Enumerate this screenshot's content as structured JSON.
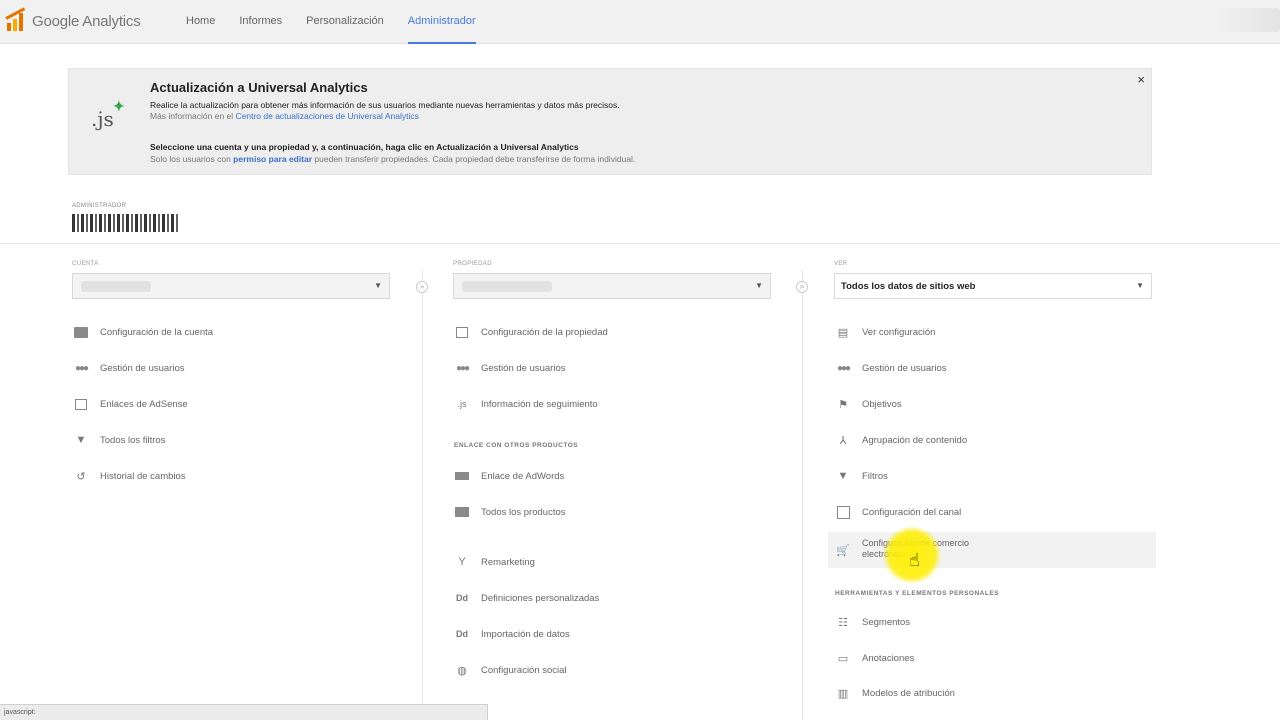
{
  "app": {
    "logo_text": "Google Analytics"
  },
  "nav": {
    "items": [
      {
        "label": "Home"
      },
      {
        "label": "Informes"
      },
      {
        "label": "Personalización"
      },
      {
        "label": "Administrador"
      }
    ],
    "active_index": 3,
    "accent": "#4a7bd6"
  },
  "banner": {
    "icon_text": ".js",
    "title": "Actualización a Universal Analytics",
    "line1": "Realice la actualización para obtener más información de sus usuarios mediante nuevas herramientas y datos más precisos.",
    "line2_prefix": "Más información en el ",
    "line2_link": "Centro de actualizaciones de Universal Analytics",
    "line3": "Seleccione una cuenta y una propiedad y, a continuación, haga clic en Actualización a Universal Analytics",
    "line4_prefix": "Solo los usuarios con ",
    "line4_link": "permiso para editar",
    "line4_suffix": " pueden transferir propiedades. Cada propiedad debe transferirse de forma individual.",
    "close": "×"
  },
  "admin": {
    "label": "ADMINISTRADOR"
  },
  "columns": {
    "account": {
      "label": "CUENTA",
      "items": [
        {
          "icon": "folder-icon",
          "label": "Configuración de la cuenta"
        },
        {
          "icon": "users-icon",
          "label": "Gestión de usuarios"
        },
        {
          "icon": "adsense-icon",
          "label": "Enlaces de AdSense"
        },
        {
          "icon": "filter-icon",
          "label": "Todos los filtros"
        },
        {
          "icon": "history-icon",
          "label": "Historial de cambios"
        }
      ]
    },
    "property": {
      "label": "PROPIEDAD",
      "items": [
        {
          "icon": "square-icon",
          "label": "Configuración de la propiedad"
        },
        {
          "icon": "users-icon",
          "label": "Gestión de usuarios"
        },
        {
          "icon": "js-icon",
          "label": "Información de seguimiento"
        }
      ],
      "section_title": "ENLACE CON OTROS PRODUCTOS",
      "section_items": [
        {
          "icon": "adwords-icon",
          "label": "Enlace de AdWords"
        },
        {
          "icon": "products-icon",
          "label": "Todos los productos"
        },
        {
          "icon": "remarketing-icon",
          "label": "Remarketing"
        },
        {
          "icon": "dd-icon",
          "label": "Definiciones personalizadas"
        },
        {
          "icon": "dd-icon",
          "label": "Importación de datos"
        },
        {
          "icon": "social-icon",
          "label": "Configuración social"
        }
      ]
    },
    "view": {
      "label": "VER",
      "select_value": "Todos los datos de sitios web",
      "items": [
        {
          "icon": "document-icon",
          "label": "Ver configuración"
        },
        {
          "icon": "users-icon",
          "label": "Gestión de usuarios"
        },
        {
          "icon": "flag-icon",
          "label": "Objetivos"
        },
        {
          "icon": "grouping-icon",
          "label": "Agrupación de contenido"
        },
        {
          "icon": "filter-icon",
          "label": "Filtros"
        },
        {
          "icon": "channel-icon",
          "label": "Configuración del canal"
        },
        {
          "icon": "cart-icon",
          "label": "Configuración de comercio electrónico"
        }
      ],
      "section_title": "HERRAMIENTAS Y ELEMENTOS PERSONALES",
      "section_items": [
        {
          "icon": "segments-icon",
          "label": "Segmentos"
        },
        {
          "icon": "annotation-icon",
          "label": "Anotaciones"
        },
        {
          "icon": "attribution-icon",
          "label": "Modelos de atribución"
        }
      ]
    }
  },
  "status_bar": {
    "text": "javascript:"
  },
  "symbols": {
    "caret": "▼",
    "sep": "»"
  }
}
